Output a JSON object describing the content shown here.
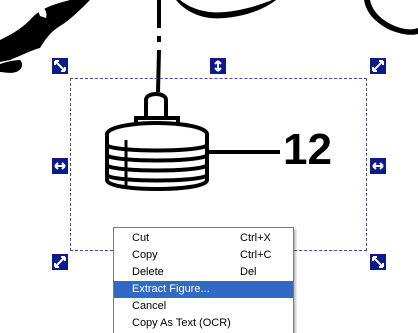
{
  "figure": {
    "callout_number": "12"
  },
  "selection": {
    "handles": [
      "resize-nw",
      "resize-n",
      "resize-ne",
      "resize-w",
      "resize-e",
      "resize-sw",
      "resize-se"
    ]
  },
  "context_menu": {
    "items": [
      {
        "label": "Cut",
        "shortcut": "Ctrl+X",
        "highlighted": false
      },
      {
        "label": "Copy",
        "shortcut": "Ctrl+C",
        "highlighted": false
      },
      {
        "label": "Delete",
        "shortcut": "Del",
        "highlighted": false
      },
      {
        "label": "Extract Figure...",
        "shortcut": "",
        "highlighted": true
      },
      {
        "label": "Cancel",
        "shortcut": "",
        "highlighted": false
      },
      {
        "label": "Copy As Text (OCR)",
        "shortcut": "",
        "highlighted": false
      }
    ],
    "highlight_color": "#316ac5"
  },
  "colors": {
    "handle": "#0c1a8c",
    "selection_border": "#4a4a9a"
  }
}
